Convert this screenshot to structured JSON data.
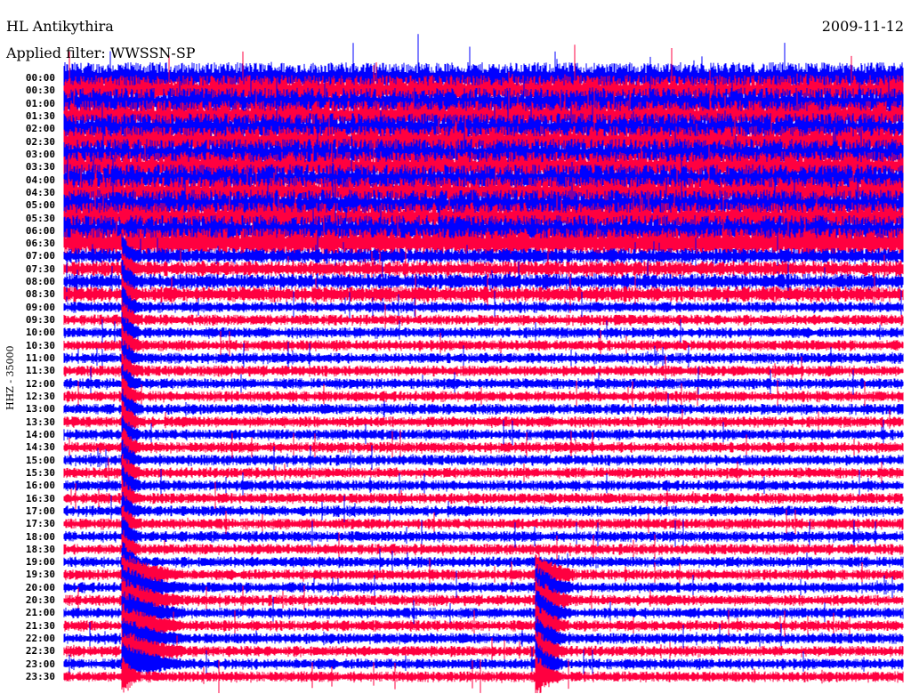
{
  "header": {
    "station": "HL Antikythira",
    "filter": "Applied filter: WWSSN-SP",
    "date": "2009-11-12"
  },
  "chart_data": {
    "type": "line",
    "subtype": "helicorder",
    "title": "HL Antikythira",
    "ylabel": "HHZ - 35000",
    "row_minutes": 30,
    "row_labels": [
      "00:00",
      "00:30",
      "01:00",
      "01:30",
      "02:00",
      "02:30",
      "03:00",
      "03:30",
      "04:00",
      "04:30",
      "05:00",
      "05:30",
      "06:00",
      "06:30",
      "07:00",
      "07:30",
      "08:00",
      "08:30",
      "09:00",
      "09:30",
      "10:00",
      "10:30",
      "11:00",
      "11:30",
      "12:00",
      "12:30",
      "13:00",
      "13:30",
      "14:00",
      "14:30",
      "15:00",
      "15:30",
      "16:00",
      "16:30",
      "17:00",
      "17:30",
      "18:00",
      "18:30",
      "19:00",
      "19:30",
      "20:00",
      "20:30",
      "21:00",
      "21:30",
      "22:00",
      "22:30",
      "23:00",
      "23:30"
    ],
    "series_colors": [
      "#0000ff",
      "#ff0040"
    ],
    "noise_level_relative": {
      "00:00-06:30": 1.0,
      "07:00-08:30": 0.55,
      "09:00-23:30": 0.35
    },
    "events": [
      {
        "row": "07:00",
        "minute_in_row": 2.2,
        "duration_rows": 34
      },
      {
        "row": "19:30",
        "minute_in_row": 17.0,
        "duration_rows": 9
      }
    ]
  }
}
